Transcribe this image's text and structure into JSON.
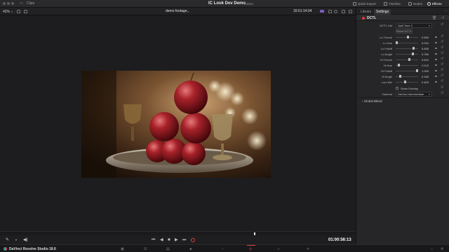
{
  "titlebar": {
    "clips_label": "Clips",
    "project_title": "IC Look Dev Demo",
    "edited_label": "Edited",
    "menu": [
      {
        "label": "Quick Export",
        "icon": "export-icon"
      },
      {
        "label": "Timeline",
        "icon": "timeline-icon"
      },
      {
        "label": "Nodes",
        "icon": "nodes-icon"
      },
      {
        "label": "Effects",
        "icon": "effects-icon"
      }
    ]
  },
  "viewer": {
    "zoom": "42%",
    "clip_name": "demo footage",
    "timecode": "16:51:14:04",
    "playhead_timecode": "01:00:56:13",
    "image_description_icon": "video-frame"
  },
  "panel": {
    "tabs": [
      "Library",
      "Settings"
    ],
    "active_tab": "Settings",
    "section_title": "DCTL",
    "dctl_list_label": "DCTL List",
    "dctl_list_value": "Split Tone 2",
    "preset_button": "Reset DCTL",
    "params": [
      {
        "label": "Lo Thresh",
        "value": "0.550",
        "fraction": 0.55
      },
      {
        "label": "Lo Hue",
        "value": "0.010",
        "fraction": 0.01
      },
      {
        "label": "Lo Falloff",
        "value": "0.835",
        "fraction": 0.835
      },
      {
        "label": "Lo Angle",
        "value": "0.780",
        "fraction": 0.78
      },
      {
        "label": "Hi Thresh",
        "value": "0.624",
        "fraction": 0.624
      },
      {
        "label": "Hi Hue",
        "value": "0.119",
        "fraction": 0.119
      },
      {
        "label": "Hi Falloff",
        "value": "1.000",
        "fraction": 1.0
      },
      {
        "label": "Hi Angle",
        "value": "0.165",
        "fraction": 0.165
      },
      {
        "label": "Lum Mix",
        "value": "0.403",
        "fraction": 0.403
      }
    ],
    "show_overlay_label": "Show Overlay",
    "gamma_label": "Gamma",
    "gamma_value": "DaVinci Intermediate",
    "global_blend_label": "Global Blend"
  },
  "app": {
    "name": "DaVinci Resolve Studio 18.6"
  },
  "colors": {
    "accent_red": "#e03a3a",
    "flag_purple": "#7e5fc2"
  }
}
